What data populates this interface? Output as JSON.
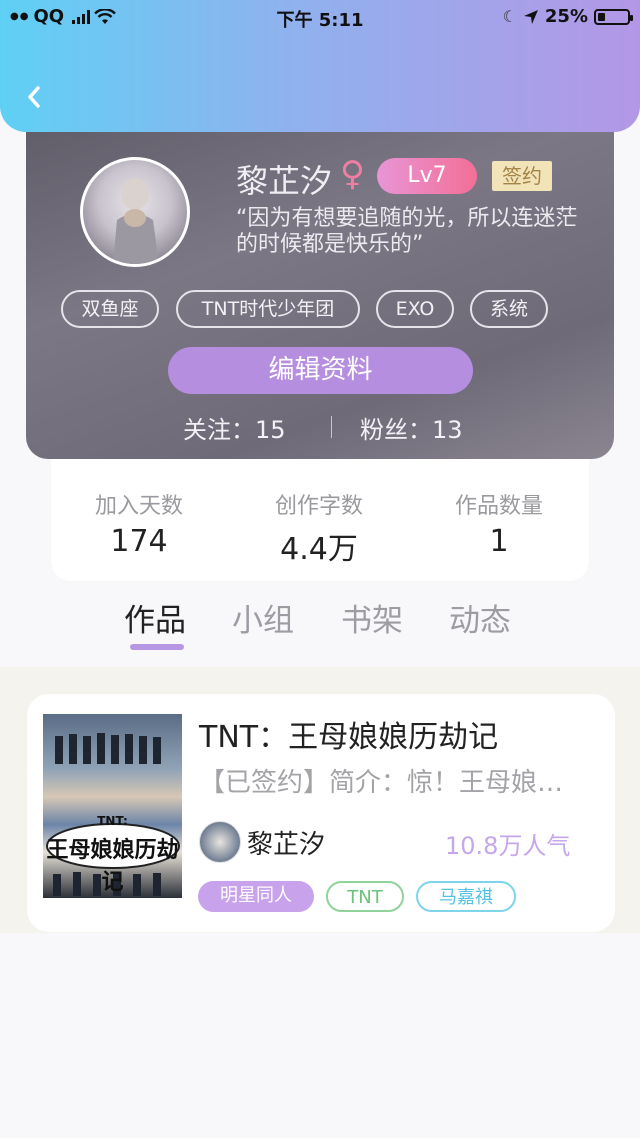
{
  "status_bar": {
    "carrier": "QQ",
    "time": "下午 5:11",
    "battery_percent": "25%",
    "battery_level": 0.25
  },
  "profile": {
    "name": "黎芷汐",
    "gender_symbol": "♀",
    "level": "Lv7",
    "signed_badge": "签约",
    "quote": "“因为有想要追随的光，所以连迷茫\n的时候都是快乐的”",
    "tags": [
      "双鱼座",
      "TNT时代少年团",
      "EXO",
      "系统"
    ],
    "edit_button": "编辑资料",
    "following_label": "关注：",
    "following": "15",
    "followers_label": "粉丝：",
    "followers": "13"
  },
  "stats": [
    {
      "label": "加入天数",
      "value": "174"
    },
    {
      "label": "创作字数",
      "value": "4.4万"
    },
    {
      "label": "作品数量",
      "value": "1"
    }
  ],
  "tabs": [
    "作品",
    "小组",
    "书架",
    "动态"
  ],
  "active_tab": "作品",
  "work": {
    "title": "TNT：王母娘娘历劫记",
    "intro": "【已签约】简介：惊！王母娘…",
    "author": "黎芷汐",
    "popularity": "10.8万人气",
    "tags": [
      "明星同人",
      "TNT",
      "马嘉祺"
    ],
    "cover_text_small": "TNT:",
    "cover_text_main": "王母娘娘历劫记"
  },
  "colors": {
    "header_start": "#5fd0f4",
    "header_end": "#b397e6",
    "accent_purple": "#b68ee0",
    "level_pink": "#f36f96"
  }
}
